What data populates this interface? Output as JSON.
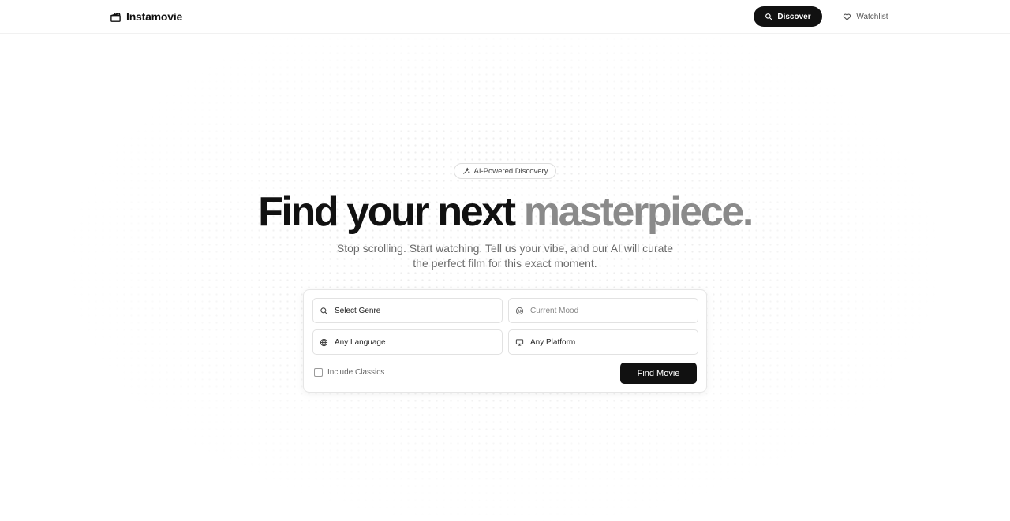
{
  "brand": {
    "name": "Instamovie",
    "icon": "clapperboard-icon"
  },
  "nav": {
    "discover_label": "Discover",
    "discover_icon": "search-icon",
    "watchlist_label": "Watchlist",
    "watchlist_icon": "heart-icon"
  },
  "hero": {
    "badge_label": "AI-Powered Discovery",
    "badge_icon": "sparkles-icon",
    "headline_main": "Find your next ",
    "headline_accent": "masterpiece.",
    "subtitle": "Stop scrolling. Start watching. Tell us your vibe, and our AI will curate the perfect film for this exact moment."
  },
  "form": {
    "genre": {
      "value": "Select Genre",
      "icon": "search-icon"
    },
    "mood": {
      "placeholder": "Current Mood",
      "value": "",
      "icon": "smile-icon"
    },
    "language": {
      "value": "Any Language",
      "icon": "globe-icon"
    },
    "platform": {
      "value": "Any Platform",
      "icon": "monitor-icon"
    },
    "classics_label": "Include Classics",
    "classics_checked": false,
    "submit_label": "Find Movie"
  },
  "colors": {
    "primary": "#111111",
    "accent_text": "#8a8a8a",
    "muted_text": "#6b6b6b",
    "background": "#ffffff"
  }
}
